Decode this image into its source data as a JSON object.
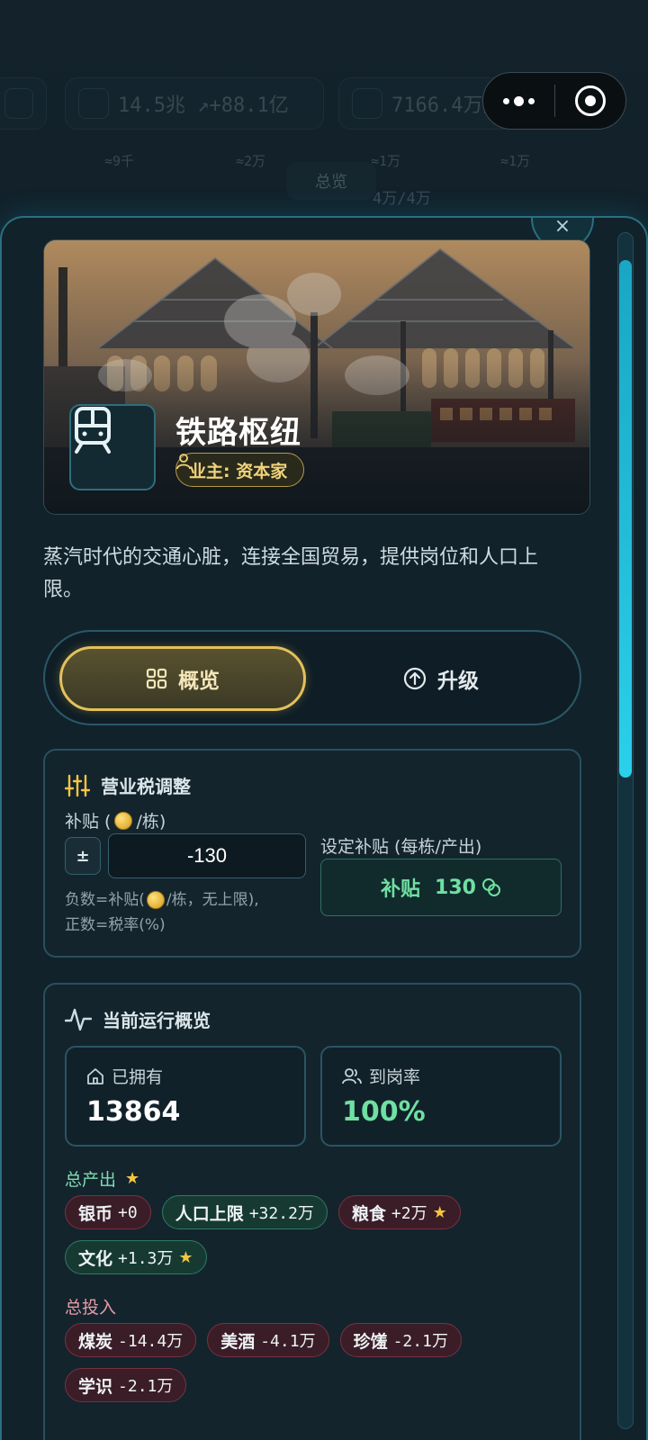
{
  "background": {
    "chips": [
      {
        "text": "14.5兆  ↗+88.1亿"
      },
      {
        "text": "7166.4万/6436.7万"
      }
    ],
    "subs": [
      "≈9千",
      "≈2万",
      "≈1万",
      "≈1万"
    ],
    "sub2": "4万/4万",
    "tab_label": "总览"
  },
  "capsule": {
    "more_icon": "more-dots-icon",
    "close_icon": "target-icon"
  },
  "panel": {
    "close_symbol": "×",
    "hero": {
      "title": "铁路枢纽",
      "owner": "业主: 资本家",
      "icon": "train-icon"
    },
    "description": "蒸汽时代的交通心脏，连接全国贸易，提供岗位和人口上限。",
    "tabs": [
      {
        "label": "概览",
        "icon": "grid-icon",
        "active": true
      },
      {
        "label": "升级",
        "icon": "upgrade-arrow-icon",
        "active": false
      }
    ],
    "tax": {
      "title": "营业税调整",
      "subsidy_label_prefix": "补贴 (",
      "subsidy_label_suffix": "/栋)",
      "pm_label": "±",
      "input_value": "-130",
      "hint_line1_prefix": "负数=补贴(",
      "hint_line1_suffix": "/栋，无上限),",
      "hint_line2": "正数=税率(%)",
      "set_label": "设定补贴 (每栋/产出)",
      "set_button_text": "补贴",
      "set_button_value": "130"
    },
    "overview": {
      "title": "当前运行概览",
      "owned_label": "已拥有",
      "owned_value": "13864",
      "attendance_label": "到岗率",
      "attendance_value": "100%",
      "output_label": "总产出",
      "outputs": [
        {
          "name": "银币",
          "amount": "+0",
          "color": "red",
          "star": false
        },
        {
          "name": "人口上限",
          "amount": "+32.2万",
          "color": "green",
          "star": false
        },
        {
          "name": "粮食",
          "amount": "+2万",
          "color": "red",
          "star": true
        },
        {
          "name": "文化",
          "amount": "+1.3万",
          "color": "green",
          "star": true
        }
      ],
      "input_label": "总投入",
      "inputs": [
        {
          "name": "煤炭",
          "amount": "-14.4万"
        },
        {
          "name": "美酒",
          "amount": "-4.1万"
        },
        {
          "name": "珍馐",
          "amount": "-2.1万"
        },
        {
          "name": "学识",
          "amount": "-2.1万"
        }
      ]
    }
  },
  "colors": {
    "accent_gold": "#e3c15b",
    "accent_cyan": "#2bd0ea",
    "positive": "#6fe0a2",
    "negative": "#e69aa6"
  }
}
